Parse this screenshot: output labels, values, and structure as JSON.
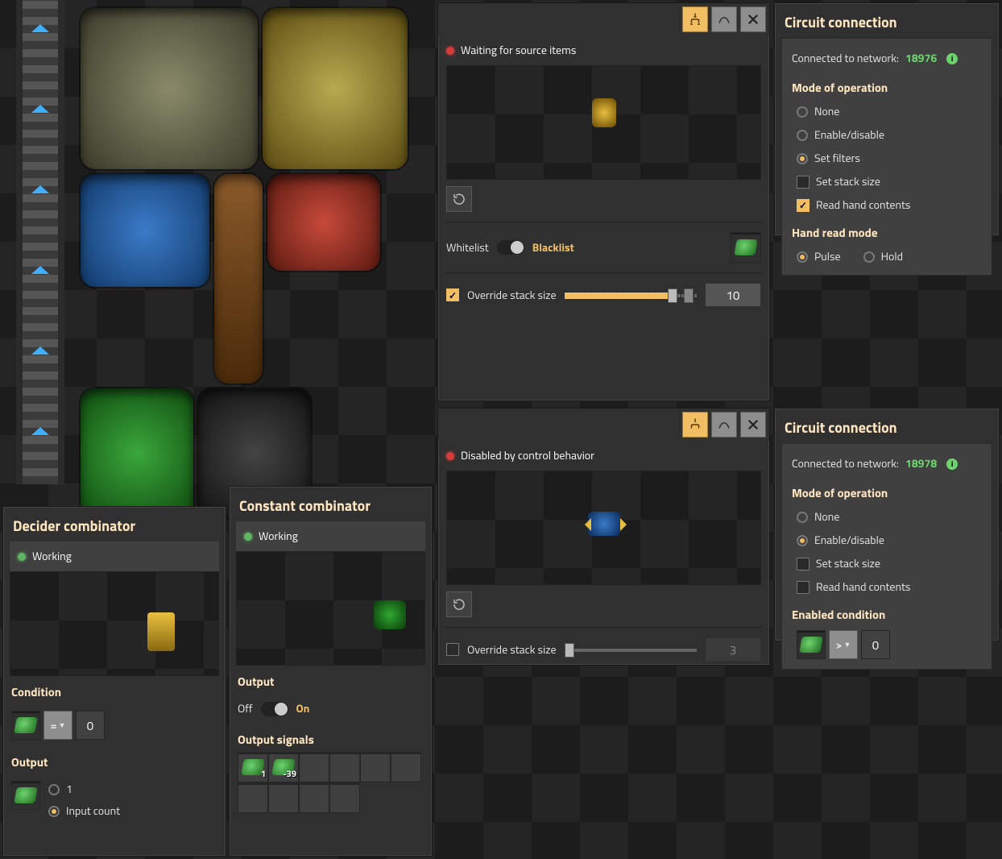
{
  "inserter1": {
    "status": "Waiting for source items",
    "whitelist_label": "Whitelist",
    "blacklist_label": "Blacklist",
    "override_label": "Override stack size",
    "override_checked": true,
    "stack_value": "10",
    "whitelist_on": false
  },
  "inserter2": {
    "status": "Disabled by control behavior",
    "override_label": "Override stack size",
    "override_checked": false,
    "stack_value": "3"
  },
  "circuit1": {
    "title": "Circuit connection",
    "network_label": "Connected to network:",
    "network_id": "18976",
    "mode_title": "Mode of operation",
    "modes": {
      "none": "None",
      "enable": "Enable/disable",
      "filters": "Set filters"
    },
    "set_stack": "Set stack size",
    "read_hand": "Read hand contents",
    "read_hand_checked": true,
    "hand_mode_title": "Hand read mode",
    "pulse": "Pulse",
    "hold": "Hold"
  },
  "circuit2": {
    "title": "Circuit connection",
    "network_label": "Connected to network:",
    "network_id": "18978",
    "mode_title": "Mode of operation",
    "modes": {
      "none": "None",
      "enable": "Enable/disable"
    },
    "set_stack": "Set stack size",
    "read_hand": "Read hand contents",
    "cond_title": "Enabled condition",
    "cond_op": ">",
    "cond_val": "0"
  },
  "decider": {
    "title": "Decider combinator",
    "status": "Working",
    "condition_title": "Condition",
    "cond_op": "=",
    "cond_val": "0",
    "output_title": "Output",
    "out_one": "1",
    "out_count": "Input count"
  },
  "constcomb": {
    "title": "Constant combinator",
    "status": "Working",
    "output_title": "Output",
    "off": "Off",
    "on": "On",
    "signals_title": "Output signals",
    "sig1_count": "1",
    "sig2_count": "-39"
  }
}
